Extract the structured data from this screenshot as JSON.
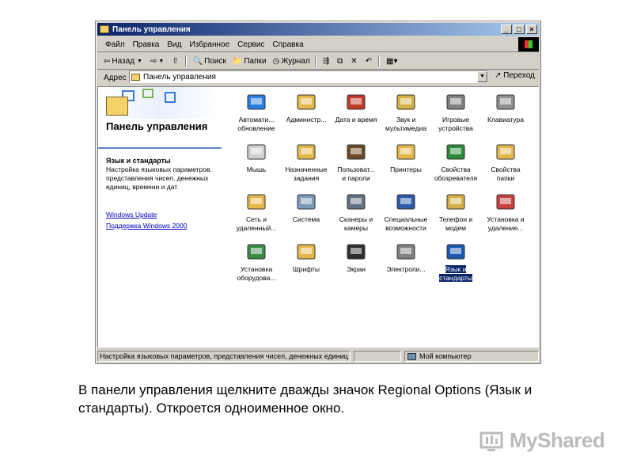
{
  "window": {
    "title": "Панель управления",
    "min": "_",
    "max": "□",
    "close": "×"
  },
  "menu": [
    "Файл",
    "Правка",
    "Вид",
    "Избранное",
    "Сервис",
    "Справка"
  ],
  "toolbar": {
    "back": "Назад",
    "back_icon": "⇦",
    "forward_icon": "⇨",
    "up_icon": "⇧",
    "search": "Поиск",
    "folders": "Папки",
    "history": "Журнал",
    "views_icon": "▦▾"
  },
  "address": {
    "label": "Адрес",
    "value": "Панель управления",
    "go": "Переход"
  },
  "left_panel": {
    "title": "Панель управления",
    "subhead": "Язык и стандарты",
    "description": "Настройка языковых параметров, представления чисел, денежных единиц, времени и дат",
    "links": [
      "Windows Update",
      "Поддержка Windows 2000"
    ]
  },
  "icons": [
    {
      "line1": "Автомати...",
      "line2": "обновление",
      "name": "windows-update-icon",
      "color": "#2a7de1"
    },
    {
      "line1": "Администр...",
      "line2": "",
      "name": "admin-tools-icon",
      "color": "#e2b84a"
    },
    {
      "line1": "Дата и время",
      "line2": "",
      "name": "date-time-icon",
      "color": "#c0392b"
    },
    {
      "line1": "Звук и",
      "line2": "мультимедиа",
      "name": "sound-icon",
      "color": "#d4b04a"
    },
    {
      "line1": "Игровые",
      "line2": "устройства",
      "name": "game-controller-icon",
      "color": "#808080"
    },
    {
      "line1": "Клавиатура",
      "line2": "",
      "name": "keyboard-icon",
      "color": "#909090"
    },
    {
      "line1": "Мышь",
      "line2": "",
      "name": "mouse-icon",
      "color": "#d0d0d0"
    },
    {
      "line1": "Назначенные",
      "line2": "задания",
      "name": "scheduled-tasks-icon",
      "color": "#e2b84a"
    },
    {
      "line1": "Пользоват...",
      "line2": "и пароли",
      "name": "users-icon",
      "color": "#6b4a2a"
    },
    {
      "line1": "Принтеры",
      "line2": "",
      "name": "printers-icon",
      "color": "#e2b84a"
    },
    {
      "line1": "Свойства",
      "line2": "обозревателя",
      "name": "internet-options-icon",
      "color": "#2a8a3a"
    },
    {
      "line1": "Свойства",
      "line2": "папки",
      "name": "folder-options-icon",
      "color": "#e2b84a"
    },
    {
      "line1": "Сеть и",
      "line2": "удаленный...",
      "name": "network-icon",
      "color": "#e2b84a"
    },
    {
      "line1": "Система",
      "line2": "",
      "name": "system-icon",
      "color": "#7a9ab8"
    },
    {
      "line1": "Сканеры и",
      "line2": "камеры",
      "name": "scanner-icon",
      "color": "#607080"
    },
    {
      "line1": "Специальные",
      "line2": "возможности",
      "name": "accessibility-icon",
      "color": "#2a5aa8"
    },
    {
      "line1": "Телефон и",
      "line2": "модем",
      "name": "phone-modem-icon",
      "color": "#d4b04a"
    },
    {
      "line1": "Установка и",
      "line2": "удаление...",
      "name": "add-remove-icon",
      "color": "#c84040"
    },
    {
      "line1": "Установка",
      "line2": "оборудова...",
      "name": "add-hardware-icon",
      "color": "#3a8a4a"
    },
    {
      "line1": "Шрифты",
      "line2": "",
      "name": "fonts-icon",
      "color": "#e2b84a"
    },
    {
      "line1": "Экран",
      "line2": "",
      "name": "display-icon",
      "color": "#303030"
    },
    {
      "line1": "Электропи...",
      "line2": "",
      "name": "power-icon",
      "color": "#808080"
    },
    {
      "line1": "Язык и",
      "line2": "стандарты",
      "name": "regional-options-icon",
      "color": "#1a5ab0",
      "selected": true
    }
  ],
  "status": {
    "text": "Настройка языковых параметров, представления чисел, денежных единиц",
    "zone": "Мой компьютер"
  },
  "caption": "В панели управления щелкните дважды значок Regional Options (Язык и стандарты). Откроется одноименное окно.",
  "brand": "MyShared"
}
